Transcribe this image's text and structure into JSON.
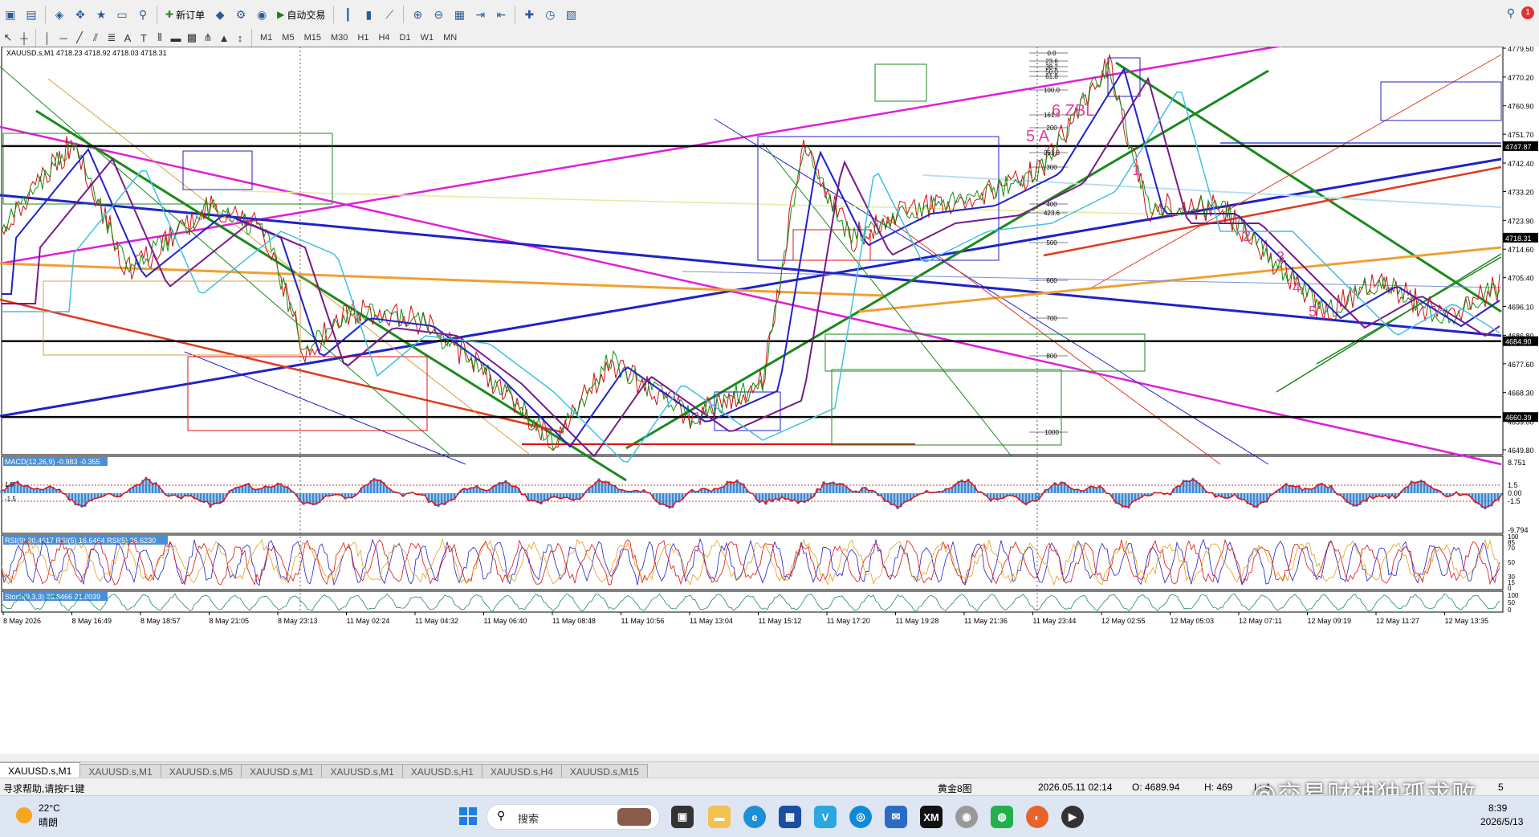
{
  "toolbar": {
    "new_order_label": "新订单",
    "autotrade_label": "自动交易",
    "timeframes": [
      "M1",
      "M5",
      "M15",
      "M30",
      "H1",
      "H4",
      "D1",
      "W1",
      "MN"
    ]
  },
  "chart": {
    "header": "XAUUSD.s,M1  4718.23 4718.92 4718.03 4718.31",
    "price_ticks": [
      "4779.50",
      "4770.20",
      "4760.90",
      "4751.70",
      "4742.40",
      "4733.20",
      "4723.90",
      "4714.60",
      "4705.40",
      "4696.10",
      "4686.80",
      "4677.60",
      "4668.30",
      "4659.00",
      "4649.80"
    ],
    "highlight_labels": [
      "4747.87",
      "4718.31",
      "4684.90",
      "4660.39"
    ],
    "fib_levels": [
      "0.0",
      "23.6",
      "38.2",
      "50.0",
      "61.8",
      "100.0",
      "161.8",
      "200",
      "261.8",
      "300",
      "400",
      "423.6",
      "500",
      "600",
      "700",
      "800",
      "1000"
    ],
    "wave_labels": [
      "1",
      "2",
      "3",
      "4",
      "5"
    ],
    "pink_text": "6 ZBL",
    "pink_text2": "5 A",
    "time_labels": [
      "8 May 2026",
      "8 May 16:49",
      "8 May 18:57",
      "8 May 21:05",
      "8 May 23:13",
      "11 May 02:24",
      "11 May 04:32",
      "11 May 06:40",
      "11 May 08:48",
      "11 May 10:56",
      "11 May 13:04",
      "11 May 15:12",
      "11 May 17:20",
      "11 May 19:28",
      "11 May 21:36",
      "11 May 23:44",
      "12 May 02:55",
      "12 May 05:03",
      "12 May 07:11",
      "12 May 09:19",
      "12 May 11:27",
      "12 May 13:35"
    ],
    "macd_label": "MACD(12,26,9) -0.983 -0.355",
    "macd_ticks": [
      "8.751",
      "1.5",
      "0.00",
      "-1.5",
      "-9.794"
    ],
    "macd_left_ticks": [
      "1.5",
      "-1.5"
    ],
    "rsi_label": "RSI(9) 30.4617  RSI(5) 16.6464  RSI(5) 36.6230",
    "rsi_ticks": [
      "100",
      "85",
      "70",
      "50",
      "30",
      "15",
      "0"
    ],
    "stoch_label": "Stoch(9,3,3) 26.8466 21.8039",
    "stoch_ticks": [
      "100",
      "50",
      "0"
    ]
  },
  "tabs": [
    "XAUUSD.s,M1",
    "XAUUSD.s,M1",
    "XAUUSD.s,M5",
    "XAUUSD.s,M1",
    "XAUUSD.s,M1",
    "XAUUSD.s,H1",
    "XAUUSD.s,H4",
    "XAUUSD.s,M15"
  ],
  "status": {
    "help": "寻求帮助,请按F1键",
    "profile": "黄金8图",
    "datetime": "2026.05.11 02:14",
    "open": "O: 4689.94",
    "high": "H: 469",
    "extra": "L: 4",
    "extra2": "5"
  },
  "taskbar": {
    "temp": "22°C",
    "weather": "晴朗",
    "search_placeholder": "搜索",
    "time": "8:39",
    "date": "2026/5/13"
  },
  "watermark": "@交易财神独孤求败"
}
